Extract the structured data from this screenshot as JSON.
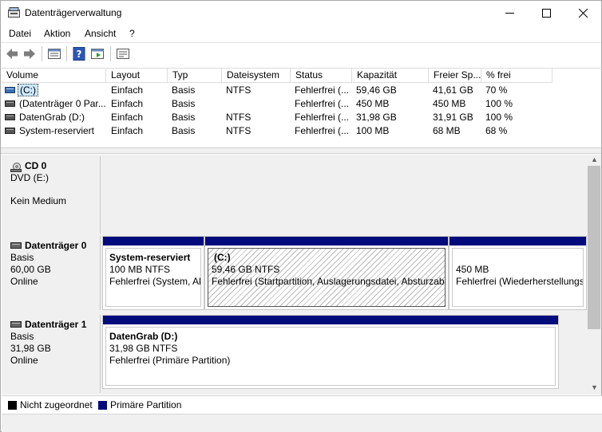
{
  "window": {
    "title": "Datenträgerverwaltung"
  },
  "menu": [
    "Datei",
    "Aktion",
    "Ansicht",
    "?"
  ],
  "columns": [
    "Volume",
    "Layout",
    "Typ",
    "Dateisystem",
    "Status",
    "Kapazität",
    "Freier Sp...",
    "% frei"
  ],
  "volumes": [
    {
      "volume": "(C:)",
      "layout": "Einfach",
      "typ": "Basis",
      "fs": "NTFS",
      "status": "Fehlerfrei (...",
      "kap": "59,46 GB",
      "frei": "41,61 GB",
      "pct": "70 %"
    },
    {
      "volume": "(Datenträger 0 Par...",
      "layout": "Einfach",
      "typ": "Basis",
      "fs": "",
      "status": "Fehlerfrei (...",
      "kap": "450 MB",
      "frei": "450 MB",
      "pct": "100 %"
    },
    {
      "volume": "DatenGrab (D:)",
      "layout": "Einfach",
      "typ": "Basis",
      "fs": "NTFS",
      "status": "Fehlerfrei (...",
      "kap": "31,98 GB",
      "frei": "31,91 GB",
      "pct": "100 %"
    },
    {
      "volume": "System-reserviert",
      "layout": "Einfach",
      "typ": "Basis",
      "fs": "NTFS",
      "status": "Fehlerfrei (...",
      "kap": "100 MB",
      "frei": "68 MB",
      "pct": "68 %"
    }
  ],
  "disks": {
    "cd0": {
      "name": "CD 0",
      "line1": "DVD (E:)",
      "line2": "Kein Medium"
    },
    "disk0": {
      "name": "Datenträger 0",
      "type": "Basis",
      "size": "60,00 GB",
      "state": "Online",
      "partitions": [
        {
          "title": "System-reserviert",
          "size": "100 MB NTFS",
          "status": "Fehlerfrei (System, Aktiv, Primäre Partition)"
        },
        {
          "title": "(C:)",
          "size": "59,46 GB NTFS",
          "status": "Fehlerfrei (Startpartition, Auslagerungsdatei, Absturzabbild, Primäre Partition)"
        },
        {
          "title": "",
          "size": "450 MB",
          "status": "Fehlerfrei (Wiederherstellungspartition)"
        }
      ]
    },
    "disk1": {
      "name": "Datenträger 1",
      "type": "Basis",
      "size": "31,98 GB",
      "state": "Online",
      "partitions": [
        {
          "title": "DatenGrab  (D:)",
          "size": "31,98 GB NTFS",
          "status": "Fehlerfrei (Primäre Partition)"
        }
      ]
    }
  },
  "legend": [
    {
      "label": "Nicht zugeordnet",
      "color": "#000000"
    },
    {
      "label": "Primäre Partition",
      "color": "#030a7c"
    }
  ],
  "colors": {
    "partition_bar": "#030a7c",
    "selection": "#cce8ff"
  }
}
